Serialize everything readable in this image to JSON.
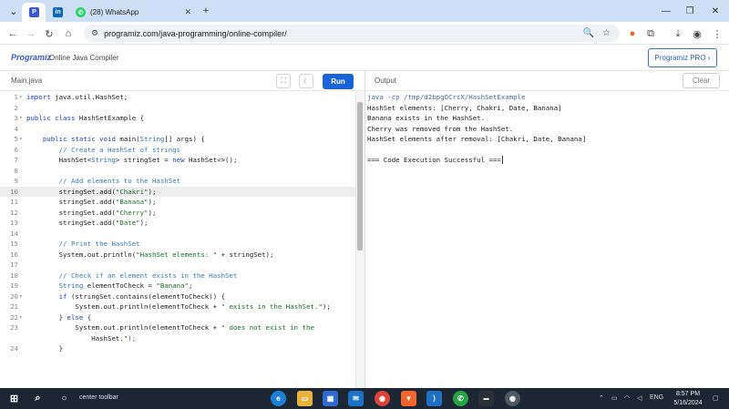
{
  "browser": {
    "tabs": [
      {
        "title": "",
        "icon": "programiz-favicon",
        "active": true
      },
      {
        "title": "",
        "icon": "linkedin-favicon",
        "active": false
      },
      {
        "title": "(28) WhatsApp",
        "icon": "whatsapp-favicon",
        "active": false
      }
    ],
    "new_tab": "+",
    "url": "programiz.com/java-programming/online-compiler/"
  },
  "site": {
    "logo": "Programiz",
    "title": "Online Java Compiler",
    "pro_button": "Programiz PRO ›"
  },
  "editor": {
    "file_tab": "Main.java",
    "run_label": "Run",
    "highlight_line": 10,
    "lines": [
      {
        "n": "1",
        "fold": "▾",
        "text": "import java.util.HashSet;"
      },
      {
        "n": "2",
        "fold": "",
        "text": ""
      },
      {
        "n": "3",
        "fold": "▾",
        "text": "public class HashSetExample {"
      },
      {
        "n": "4",
        "fold": "",
        "text": ""
      },
      {
        "n": "5",
        "fold": "▾",
        "text": "    public static void main(String[] args) {"
      },
      {
        "n": "6",
        "fold": "",
        "text": "        // Create a HashSet of strings"
      },
      {
        "n": "7",
        "fold": "",
        "text": "        HashSet<String> stringSet = new HashSet<>();"
      },
      {
        "n": "8",
        "fold": "",
        "text": ""
      },
      {
        "n": "9",
        "fold": "",
        "text": "        // Add elements to the HashSet"
      },
      {
        "n": "10",
        "fold": "",
        "text": "        stringSet.add(\"Chakri\");"
      },
      {
        "n": "11",
        "fold": "",
        "text": "        stringSet.add(\"Banana\");"
      },
      {
        "n": "12",
        "fold": "",
        "text": "        stringSet.add(\"Cherry\");"
      },
      {
        "n": "13",
        "fold": "",
        "text": "        stringSet.add(\"Date\");"
      },
      {
        "n": "14",
        "fold": "",
        "text": ""
      },
      {
        "n": "15",
        "fold": "",
        "text": "        // Print the HashSet"
      },
      {
        "n": "16",
        "fold": "",
        "text": "        System.out.println(\"HashSet elements: \" + stringSet);"
      },
      {
        "n": "17",
        "fold": "",
        "text": ""
      },
      {
        "n": "18",
        "fold": "",
        "text": "        // Check if an element exists in the HashSet"
      },
      {
        "n": "19",
        "fold": "",
        "text": "        String elementToCheck = \"Banana\";"
      },
      {
        "n": "20",
        "fold": "▾",
        "text": "        if (stringSet.contains(elementToCheck)) {"
      },
      {
        "n": "21",
        "fold": "",
        "text": "            System.out.println(elementToCheck + \" exists in the HashSet.\");"
      },
      {
        "n": "22",
        "fold": "▾",
        "text": "        } else {"
      },
      {
        "n": "23",
        "fold": "",
        "text": "            System.out.println(elementToCheck + \" does not exist in the"
      },
      {
        "n": "",
        "fold": "",
        "text": "                HashSet.\");"
      },
      {
        "n": "24",
        "fold": "",
        "text": "        }"
      }
    ]
  },
  "output": {
    "label": "Output",
    "clear_label": "Clear",
    "lines": [
      "java -cp /tmp/d2bpgOCrsX/HashSetExample",
      "HashSet elements: [Cherry, Chakri, Date, Banana]",
      "Banana exists in the HashSet.",
      "Cherry was removed from the HashSet.",
      "HashSet elements after removal: [Chakri, Date, Banana]",
      "",
      "=== Code Execution Successful ==="
    ]
  },
  "taskbar": {
    "search_text": "center toolbar",
    "language": "ENG",
    "time": "8:57 PM",
    "date": "5/16/2024"
  },
  "colors": {
    "run_button": "#1a63d6",
    "tab_strip": "#cfe0f6",
    "taskbar": "#1d2633"
  }
}
